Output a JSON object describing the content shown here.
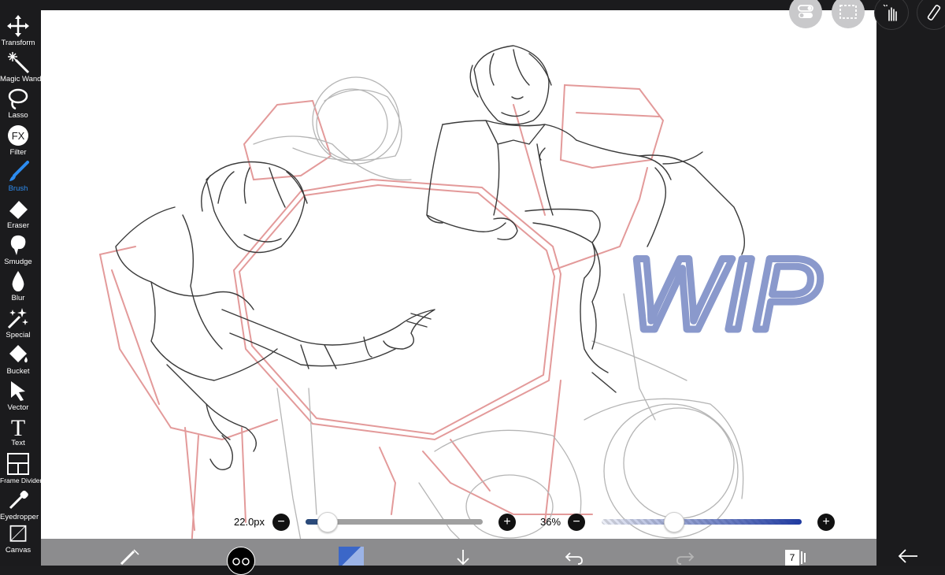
{
  "tools": [
    {
      "id": "transform",
      "label": "Transform",
      "icon": "transform-icon"
    },
    {
      "id": "magic-wand",
      "label": "Magic Wand",
      "icon": "magic-wand-icon"
    },
    {
      "id": "lasso",
      "label": "Lasso",
      "icon": "lasso-icon"
    },
    {
      "id": "filter",
      "label": "Filter",
      "icon": "filter-icon",
      "glyph": "FX"
    },
    {
      "id": "brush",
      "label": "Brush",
      "icon": "brush-icon",
      "active": true
    },
    {
      "id": "eraser",
      "label": "Eraser",
      "icon": "eraser-icon"
    },
    {
      "id": "smudge",
      "label": "Smudge",
      "icon": "smudge-icon"
    },
    {
      "id": "blur",
      "label": "Blur",
      "icon": "blur-icon"
    },
    {
      "id": "special",
      "label": "Special",
      "icon": "special-icon"
    },
    {
      "id": "bucket",
      "label": "Bucket",
      "icon": "bucket-icon"
    },
    {
      "id": "vector",
      "label": "Vector",
      "icon": "vector-icon"
    },
    {
      "id": "text",
      "label": "Text",
      "icon": "text-icon",
      "glyph": "T"
    },
    {
      "id": "frame-divider",
      "label": "Frame Divider",
      "icon": "frame-divider-icon"
    },
    {
      "id": "eyedropper",
      "label": "Eyedropper",
      "icon": "eyedropper-icon"
    },
    {
      "id": "canvas",
      "label": "Canvas",
      "icon": "canvas-icon"
    }
  ],
  "brush_size": {
    "label": "22.0px",
    "value_fraction": 0.12
  },
  "opacity": {
    "label": "36%",
    "value_fraction": 0.36
  },
  "canvas_text": "WIP",
  "bottom": {
    "layer_count": "7"
  },
  "colors": {
    "accent": "#2d8cf0",
    "brush_color": "#1f3aa0",
    "wip_color": "#8a99cc",
    "sketch_red": "#e39a9a"
  }
}
